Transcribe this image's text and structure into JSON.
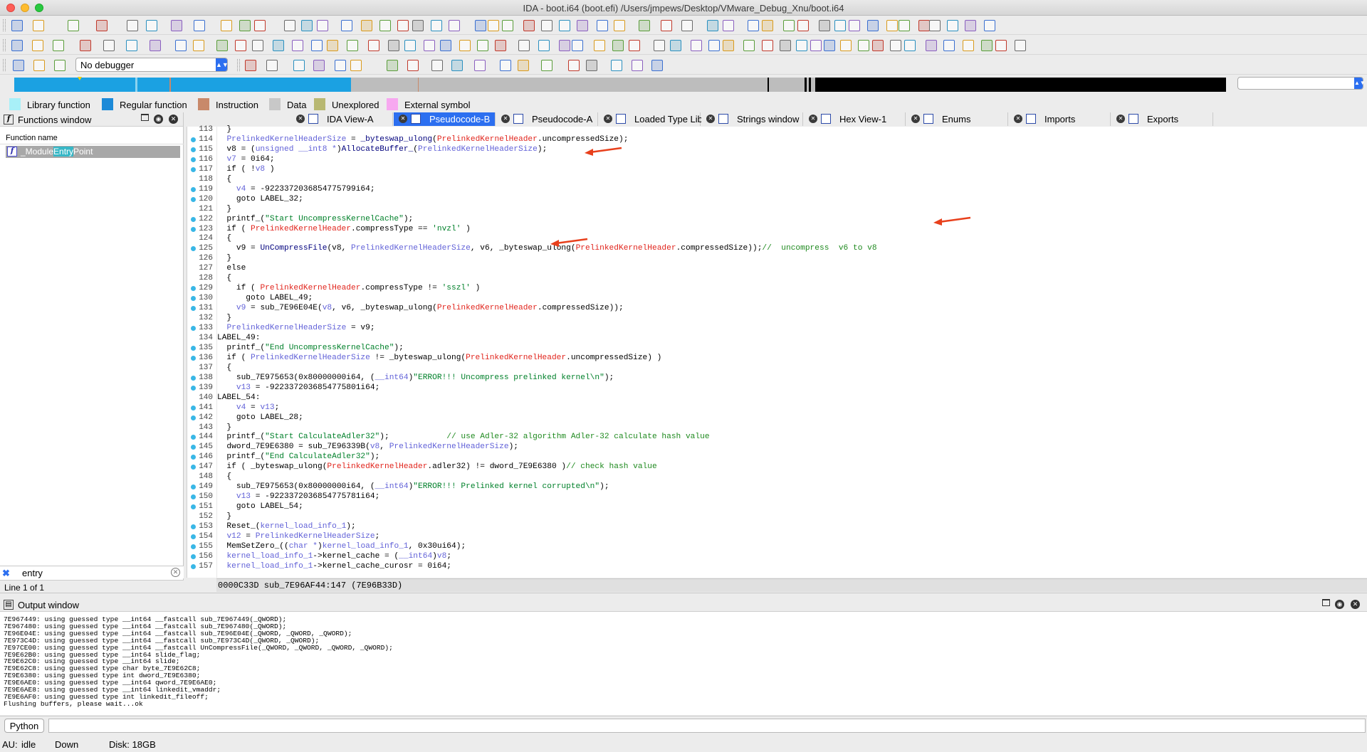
{
  "window": {
    "title": "IDA - boot.i64 (boot.efi) /Users/jmpews/Desktop/VMware_Debug_Xnu/boot.i64"
  },
  "debugger": {
    "selected": "No debugger"
  },
  "legend": [
    {
      "label": "Library function",
      "color": "#a8f0f8"
    },
    {
      "label": "Regular function",
      "color": "#1c8ad8"
    },
    {
      "label": "Instruction",
      "color": "#c8896a"
    },
    {
      "label": "Data",
      "color": "#c8c8c8"
    },
    {
      "label": "Unexplored",
      "color": "#b8b872"
    },
    {
      "label": "External symbol",
      "color": "#f7a8f0"
    }
  ],
  "functions_window": {
    "title": "Functions window",
    "column": "Function name",
    "function": {
      "pre": "_Module",
      "hl": "Entry",
      "post": "Point"
    },
    "search": "entry",
    "status": "Line 1 of 1"
  },
  "tabs": [
    {
      "label": "IDA View-A",
      "active": false
    },
    {
      "label": "Pseudocode-B",
      "active": true
    },
    {
      "label": "Pseudocode-A",
      "active": false
    },
    {
      "label": "Loaded Type Libraries",
      "active": false
    },
    {
      "label": "Strings window",
      "active": false
    },
    {
      "label": "Hex View-1",
      "active": false
    },
    {
      "label": "Enums",
      "active": false
    },
    {
      "label": "Imports",
      "active": false
    },
    {
      "label": "Exports",
      "active": false
    }
  ],
  "code": {
    "lines": [
      {
        "n": "113",
        "dot": false,
        "t": [
          [
            "  }",
            ""
          ]
        ]
      },
      {
        "n": "114",
        "dot": true,
        "t": [
          [
            "  ",
            ""
          ],
          [
            "PrelinkedKernelHeaderSize",
            "lv"
          ],
          [
            " = ",
            ""
          ],
          [
            "_byteswap_ulong",
            "fn"
          ],
          [
            "(",
            ""
          ],
          [
            "PrelinkedKernelHeader",
            "gv"
          ],
          [
            ".uncompressedSize);",
            ""
          ]
        ]
      },
      {
        "n": "115",
        "dot": true,
        "t": [
          [
            "  v8 = (",
            ""
          ],
          [
            "unsigned __int8 *",
            "lv"
          ],
          [
            ")",
            ""
          ],
          [
            "AllocateBuffer_",
            "fn"
          ],
          [
            "(",
            ""
          ],
          [
            "PrelinkedKernelHeaderSize",
            "lv"
          ],
          [
            ");",
            ""
          ]
        ]
      },
      {
        "n": "116",
        "dot": true,
        "t": [
          [
            "  ",
            ""
          ],
          [
            "v7",
            "lv"
          ],
          [
            " = 0i64;",
            ""
          ]
        ]
      },
      {
        "n": "117",
        "dot": true,
        "t": [
          [
            "  if ( !",
            ""
          ],
          [
            "v8",
            "lv"
          ],
          [
            " )",
            ""
          ]
        ]
      },
      {
        "n": "118",
        "dot": false,
        "t": [
          [
            "  {",
            ""
          ]
        ]
      },
      {
        "n": "119",
        "dot": true,
        "t": [
          [
            "    ",
            ""
          ],
          [
            "v4",
            "lv"
          ],
          [
            " = -9223372036854775799i64;",
            ""
          ]
        ]
      },
      {
        "n": "120",
        "dot": true,
        "t": [
          [
            "    goto LABEL_32;",
            ""
          ]
        ]
      },
      {
        "n": "121",
        "dot": false,
        "t": [
          [
            "  }",
            ""
          ]
        ]
      },
      {
        "n": "122",
        "dot": true,
        "t": [
          [
            "  printf_(",
            ""
          ],
          [
            "\"Start UncompressKernelCache\"",
            "str"
          ],
          [
            ");",
            ""
          ]
        ]
      },
      {
        "n": "123",
        "dot": true,
        "t": [
          [
            "  if ( ",
            ""
          ],
          [
            "PrelinkedKernelHeader",
            "gv"
          ],
          [
            ".compressType == ",
            ""
          ],
          [
            "'nvzl'",
            "str"
          ],
          [
            " )",
            ""
          ]
        ]
      },
      {
        "n": "124",
        "dot": false,
        "t": [
          [
            "  {",
            ""
          ]
        ]
      },
      {
        "n": "125",
        "dot": true,
        "t": [
          [
            "    v9 = ",
            ""
          ],
          [
            "UnCompressFile",
            "fn"
          ],
          [
            "(v8, ",
            ""
          ],
          [
            "PrelinkedKernelHeaderSize",
            "lv"
          ],
          [
            ", v6, _byteswap_ulong(",
            ""
          ],
          [
            "PrelinkedKernelHeader",
            "gv"
          ],
          [
            ".compressedSize));",
            ""
          ],
          [
            "//  uncompress  v6 to v8",
            "cm"
          ]
        ]
      },
      {
        "n": "126",
        "dot": false,
        "t": [
          [
            "  }",
            ""
          ]
        ]
      },
      {
        "n": "127",
        "dot": false,
        "t": [
          [
            "  else",
            ""
          ]
        ]
      },
      {
        "n": "128",
        "dot": false,
        "t": [
          [
            "  {",
            ""
          ]
        ]
      },
      {
        "n": "129",
        "dot": true,
        "t": [
          [
            "    if ( ",
            ""
          ],
          [
            "PrelinkedKernelHeader",
            "gv"
          ],
          [
            ".compressType != ",
            ""
          ],
          [
            "'sszl'",
            "str"
          ],
          [
            " )",
            ""
          ]
        ]
      },
      {
        "n": "130",
        "dot": true,
        "t": [
          [
            "      goto LABEL_49;",
            ""
          ]
        ]
      },
      {
        "n": "131",
        "dot": true,
        "t": [
          [
            "    ",
            ""
          ],
          [
            "v9",
            "lv"
          ],
          [
            " = sub_7E96E04E(",
            ""
          ],
          [
            "v8",
            "lv"
          ],
          [
            ", v6, _byteswap_ulong(",
            ""
          ],
          [
            "PrelinkedKernelHeader",
            "gv"
          ],
          [
            ".compressedSize));",
            ""
          ]
        ]
      },
      {
        "n": "132",
        "dot": false,
        "t": [
          [
            "  }",
            ""
          ]
        ]
      },
      {
        "n": "133",
        "dot": true,
        "t": [
          [
            "  ",
            ""
          ],
          [
            "PrelinkedKernelHeaderSize",
            "lv"
          ],
          [
            " = v9;",
            ""
          ]
        ]
      },
      {
        "n": "134",
        "dot": false,
        "t": [
          [
            "LABEL_49:",
            ""
          ]
        ]
      },
      {
        "n": "135",
        "dot": true,
        "t": [
          [
            "  printf_(",
            ""
          ],
          [
            "\"End UncompressKernelCache\"",
            "str"
          ],
          [
            ");",
            ""
          ]
        ]
      },
      {
        "n": "136",
        "dot": true,
        "t": [
          [
            "  if ( ",
            ""
          ],
          [
            "PrelinkedKernelHeaderSize",
            "lv"
          ],
          [
            " != _byteswap_ulong(",
            ""
          ],
          [
            "PrelinkedKernelHeader",
            "gv"
          ],
          [
            ".uncompressedSize) )",
            ""
          ]
        ]
      },
      {
        "n": "137",
        "dot": false,
        "t": [
          [
            "  {",
            ""
          ]
        ]
      },
      {
        "n": "138",
        "dot": true,
        "t": [
          [
            "    sub_7E975653(0x80000000i64, (",
            ""
          ],
          [
            "__int64",
            "lv"
          ],
          [
            ")",
            ""
          ],
          [
            "\"ERROR!!! Uncompress prelinked kernel\\n\"",
            "str"
          ],
          [
            ");",
            ""
          ]
        ]
      },
      {
        "n": "139",
        "dot": true,
        "t": [
          [
            "    ",
            ""
          ],
          [
            "v13",
            "lv"
          ],
          [
            " = -9223372036854775801i64;",
            ""
          ]
        ]
      },
      {
        "n": "140",
        "dot": false,
        "t": [
          [
            "LABEL_54:",
            ""
          ]
        ]
      },
      {
        "n": "141",
        "dot": true,
        "t": [
          [
            "    ",
            ""
          ],
          [
            "v4",
            "lv"
          ],
          [
            " = ",
            ""
          ],
          [
            "v13",
            "lv"
          ],
          [
            ";",
            ""
          ]
        ]
      },
      {
        "n": "142",
        "dot": true,
        "t": [
          [
            "    goto LABEL_28;",
            ""
          ]
        ]
      },
      {
        "n": "143",
        "dot": false,
        "t": [
          [
            "  }",
            ""
          ]
        ]
      },
      {
        "n": "144",
        "dot": true,
        "t": [
          [
            "  printf_(",
            ""
          ],
          [
            "\"Start CalculateAdler32\"",
            "str"
          ],
          [
            ");            ",
            ""
          ],
          [
            "// use Adler-32 algorithm Adler-32 calculate hash value",
            "cm"
          ]
        ]
      },
      {
        "n": "145",
        "dot": true,
        "t": [
          [
            "  dword_7E9E6380 = sub_7E96339B(",
            ""
          ],
          [
            "v8",
            "lv"
          ],
          [
            ", ",
            ""
          ],
          [
            "PrelinkedKernelHeaderSize",
            "lv"
          ],
          [
            ");",
            ""
          ]
        ]
      },
      {
        "n": "146",
        "dot": true,
        "t": [
          [
            "  printf_(",
            ""
          ],
          [
            "\"End CalculateAdler32\"",
            "str"
          ],
          [
            ");",
            ""
          ]
        ]
      },
      {
        "n": "147",
        "dot": true,
        "t": [
          [
            "  if ( _byteswap_ulong(",
            ""
          ],
          [
            "PrelinkedKernelHeader",
            "gv"
          ],
          [
            ".adler32) != dword_7E9E6380 )",
            ""
          ],
          [
            "// check hash value",
            "cm"
          ]
        ]
      },
      {
        "n": "148",
        "dot": false,
        "t": [
          [
            "  {",
            ""
          ]
        ]
      },
      {
        "n": "149",
        "dot": true,
        "t": [
          [
            "    sub_7E975653(0x80000000i64, (",
            ""
          ],
          [
            "__int64",
            "lv"
          ],
          [
            ")",
            ""
          ],
          [
            "\"ERROR!!! Prelinked kernel corrupted\\n\"",
            "str"
          ],
          [
            ");",
            ""
          ]
        ]
      },
      {
        "n": "150",
        "dot": true,
        "t": [
          [
            "    ",
            ""
          ],
          [
            "v13",
            "lv"
          ],
          [
            " = -9223372036854775781i64;",
            ""
          ]
        ]
      },
      {
        "n": "151",
        "dot": true,
        "t": [
          [
            "    goto LABEL_54;",
            ""
          ]
        ]
      },
      {
        "n": "152",
        "dot": false,
        "t": [
          [
            "  }",
            ""
          ]
        ]
      },
      {
        "n": "153",
        "dot": true,
        "t": [
          [
            "  Reset_(",
            ""
          ],
          [
            "kernel_load_info_1",
            "lv"
          ],
          [
            ");",
            ""
          ]
        ]
      },
      {
        "n": "154",
        "dot": true,
        "t": [
          [
            "  ",
            ""
          ],
          [
            "v12",
            "lv"
          ],
          [
            " = ",
            ""
          ],
          [
            "PrelinkedKernelHeaderSize",
            "lv"
          ],
          [
            ";",
            ""
          ]
        ]
      },
      {
        "n": "155",
        "dot": true,
        "t": [
          [
            "  MemSetZero_((",
            ""
          ],
          [
            "char *",
            "lv"
          ],
          [
            ")",
            ""
          ],
          [
            "kernel_load_info_1",
            "lv"
          ],
          [
            ", 0x30ui64);",
            ""
          ]
        ]
      },
      {
        "n": "156",
        "dot": true,
        "t": [
          [
            "  ",
            ""
          ],
          [
            "kernel_load_info_1",
            "lv"
          ],
          [
            "->kernel_cache = (",
            ""
          ],
          [
            "__int64",
            "lv"
          ],
          [
            ")",
            ""
          ],
          [
            "v8",
            "lv"
          ],
          [
            ";",
            ""
          ]
        ]
      },
      {
        "n": "157",
        "dot": true,
        "t": [
          [
            "  ",
            ""
          ],
          [
            "kernel_load_info_1",
            "lv"
          ],
          [
            "->kernel_cache_curosr = 0i64;",
            ""
          ]
        ]
      }
    ],
    "status": "0000C33D  sub_7E96AF44:147 (7E96B33D)"
  },
  "output_window": {
    "title": "Output window",
    "lines": [
      "7E967449: using guessed type __int64 __fastcall sub_7E967449(_QWORD);",
      "7E967480: using guessed type __int64 __fastcall sub_7E967480(_QWORD);",
      "7E96E04E: using guessed type __int64 __fastcall sub_7E96E04E(_QWORD, _QWORD, _QWORD);",
      "7E973C4D: using guessed type __int64 __fastcall sub_7E973C4D(_QWORD, _QWORD);",
      "7E97CE00: using guessed type __int64 __fastcall UnCompressFile(_QWORD, _QWORD, _QWORD, _QWORD);",
      "7E9E62B0: using guessed type __int64 slide_flag;",
      "7E9E62C0: using guessed type __int64 slide;",
      "7E9E62C8: using guessed type char byte_7E9E62C8;",
      "7E9E6380: using guessed type int dword_7E9E6380;",
      "7E9E6AE0: using guessed type __int64 qword_7E9E6AE0;",
      "7E9E6AE8: using guessed type __int64 linkedit_vmaddr;",
      "7E9E6AF0: using guessed type int linkedit_fileoff;",
      "Flushing buffers, please wait...ok"
    ]
  },
  "python": {
    "label": "Python"
  },
  "statusbar": {
    "au": "AU:",
    "state": "idle",
    "direction": "Down",
    "disk": "Disk: 18GB"
  }
}
